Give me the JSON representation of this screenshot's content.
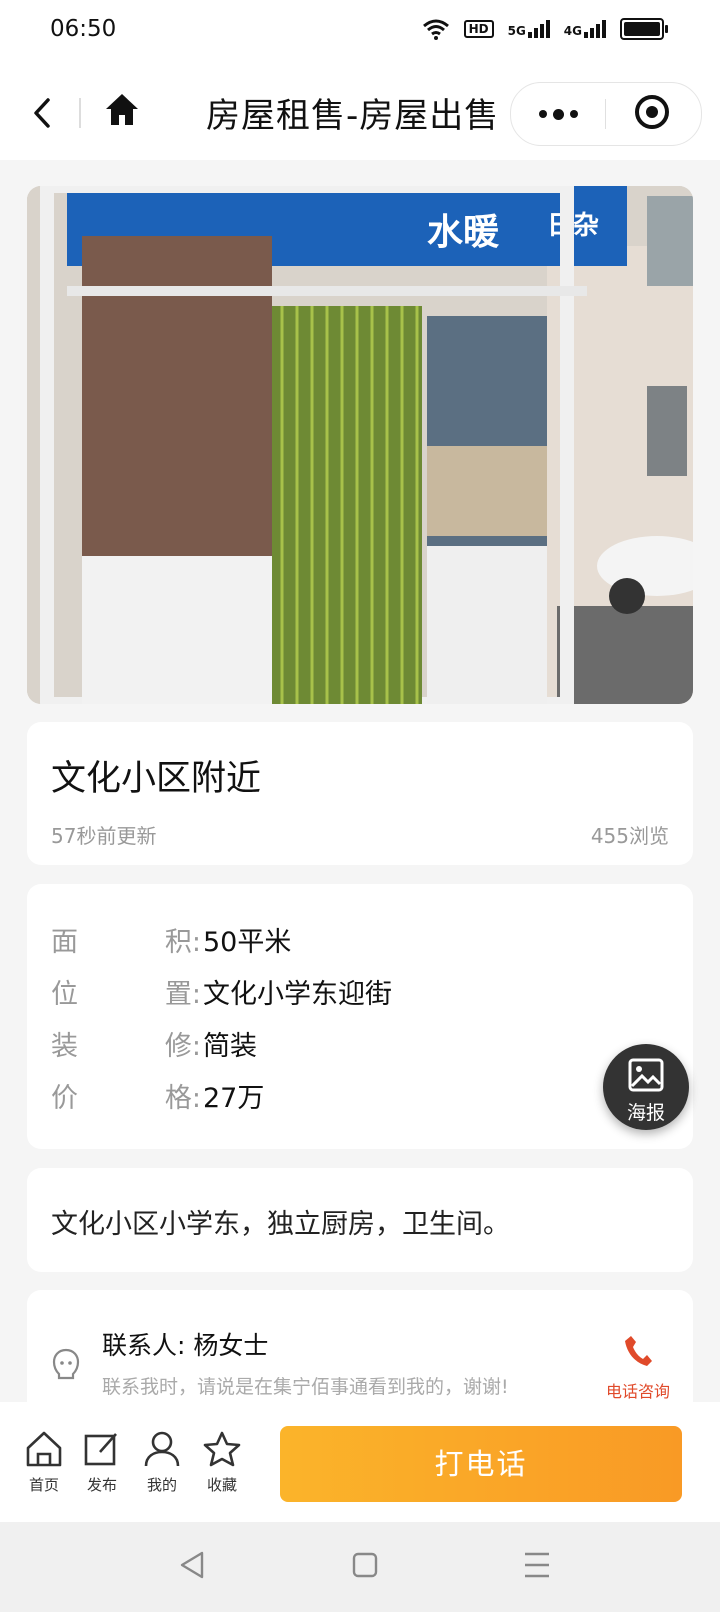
{
  "status_bar": {
    "time": "06:50",
    "hd": "HD",
    "net1": "5G",
    "net2": "4G"
  },
  "nav": {
    "title": "房屋租售-房屋出售"
  },
  "listing": {
    "title": "文化小区附近",
    "updated": "57秒前更新",
    "views": "455浏览",
    "details": [
      {
        "label_a": "面",
        "label_b": "积",
        "value": "50平米"
      },
      {
        "label_a": "位",
        "label_b": "置",
        "value": "文化小学东迎街"
      },
      {
        "label_a": "装",
        "label_b": "修",
        "value": "简装"
      },
      {
        "label_a": "价",
        "label_b": "格",
        "value": "27万"
      }
    ],
    "description": "文化小区小学东，独立厨房，卫生间。"
  },
  "photo": {
    "sign_text_1": "水暖",
    "sign_text_2": "日杂"
  },
  "contact": {
    "label": "联系人: 杨女士",
    "note": "联系我时，请说是在集宁佰事通看到我的，谢谢!",
    "phone_label": "电话咨询"
  },
  "poster": {
    "label": "海报"
  },
  "tabs": [
    {
      "label": "首页",
      "icon": "home-icon"
    },
    {
      "label": "发布",
      "icon": "edit-icon"
    },
    {
      "label": "我的",
      "icon": "user-icon"
    },
    {
      "label": "收藏",
      "icon": "star-icon"
    }
  ],
  "call_button": {
    "label": "打电话"
  },
  "colors": {
    "accent": "#f9a62a",
    "phone": "#e04a2a"
  }
}
